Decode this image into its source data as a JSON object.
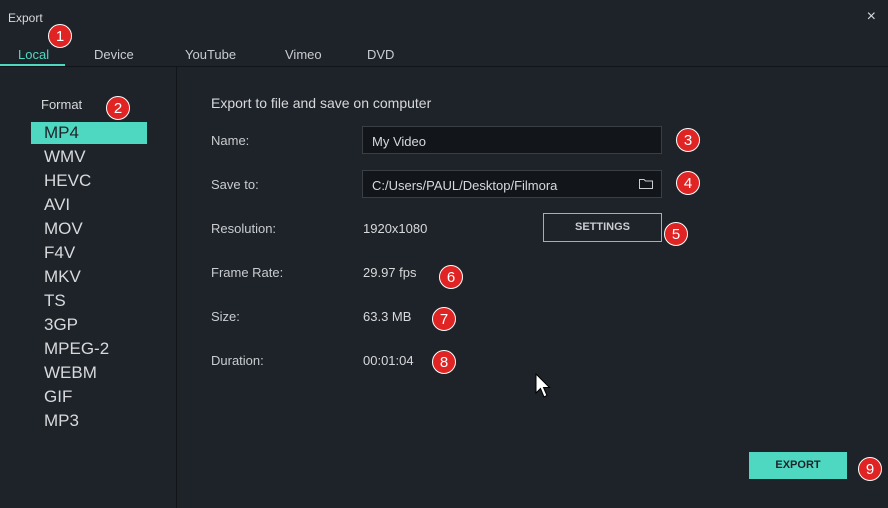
{
  "window": {
    "title": "Export",
    "close_symbol": "×"
  },
  "tabs": [
    {
      "label": "Local",
      "active": true
    },
    {
      "label": "Device"
    },
    {
      "label": "YouTube"
    },
    {
      "label": "Vimeo"
    },
    {
      "label": "DVD"
    }
  ],
  "format": {
    "title": "Format",
    "items": [
      "MP4",
      "WMV",
      "HEVC",
      "AVI",
      "MOV",
      "F4V",
      "MKV",
      "TS",
      "3GP",
      "MPEG-2",
      "WEBM",
      "GIF",
      "MP3"
    ],
    "selected": "MP4"
  },
  "main": {
    "heading": "Export to file and save on computer",
    "name_label": "Name:",
    "name_value": "My Video",
    "save_label": "Save to:",
    "save_value": "C:/Users/PAUL/Desktop/Filmora",
    "resolution_label": "Resolution:",
    "resolution_value": "1920x1080",
    "settings_label": "SETTINGS",
    "framerate_label": "Frame Rate:",
    "framerate_value": "29.97 fps",
    "size_label": "Size:",
    "size_value": "63.3 MB",
    "duration_label": "Duration:",
    "duration_value": "00:01:04",
    "export_label": "EXPORT"
  },
  "badges": [
    "1",
    "2",
    "3",
    "4",
    "5",
    "6",
    "7",
    "8",
    "9"
  ],
  "icons": {
    "folder": "folder-icon",
    "close": "close-icon",
    "cursor": "mouse-pointer-icon"
  },
  "colors": {
    "accent": "#4ed8c2",
    "background": "#1e2329",
    "badge": "#e02424"
  }
}
